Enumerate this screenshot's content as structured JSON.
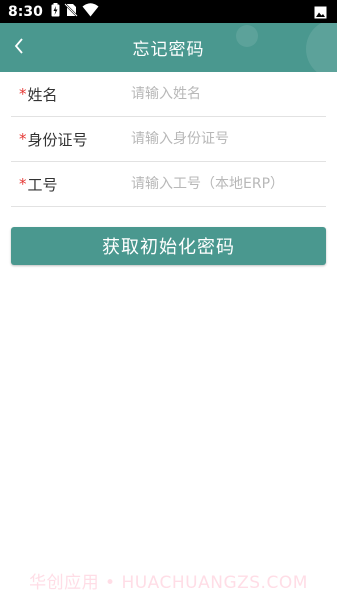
{
  "status_bar": {
    "time": "8:30",
    "icons": [
      "battery-charging-icon",
      "no-sim-icon",
      "wifi-icon",
      "image-notification-icon"
    ]
  },
  "header": {
    "title": "忘记密码",
    "back_icon": "chevron-left-icon",
    "accent_color": "#4a988f"
  },
  "form": {
    "required_mark": "*",
    "fields": [
      {
        "label": "姓名",
        "placeholder": "请输入姓名",
        "value": ""
      },
      {
        "label": "身份证号",
        "placeholder": "请输入身份证号",
        "value": ""
      },
      {
        "label": "工号",
        "placeholder": "请输入工号（本地ERP）",
        "value": ""
      }
    ]
  },
  "actions": {
    "submit_label": "获取初始化密码"
  },
  "watermark": "华创应用 • HUACHUANGZS.COM"
}
